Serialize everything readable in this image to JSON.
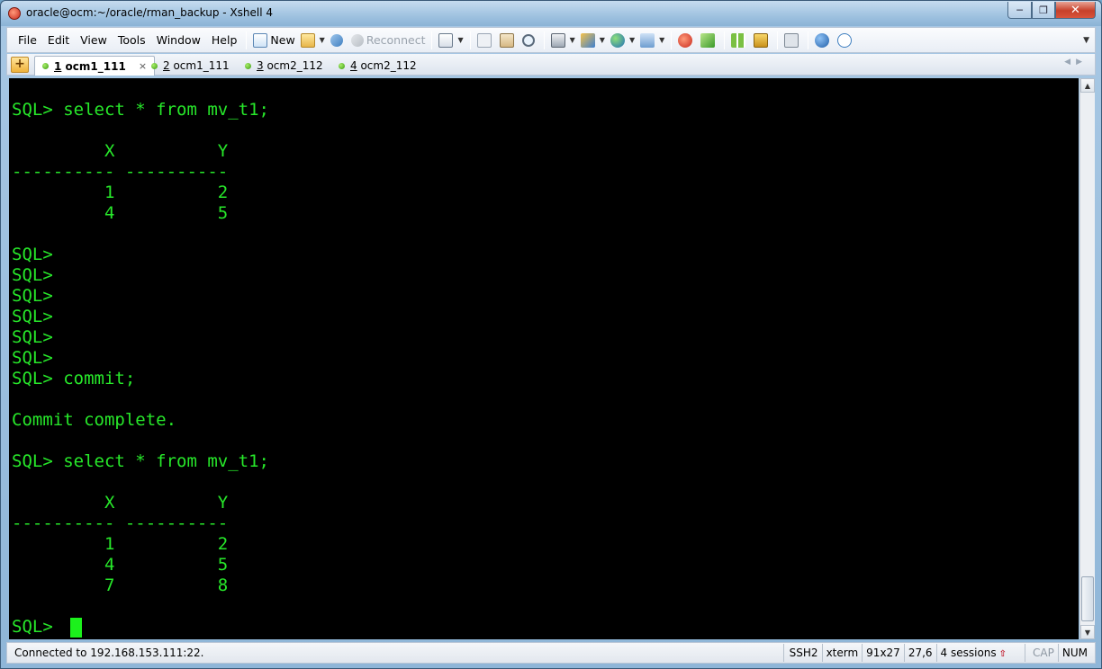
{
  "window": {
    "title": "oracle@ocm:~/oracle/rman_backup - Xshell 4"
  },
  "menu": [
    "File",
    "Edit",
    "View",
    "Tools",
    "Window",
    "Help"
  ],
  "toolbar": {
    "new_label": "New",
    "reconnect_label": "Reconnect"
  },
  "tabs": [
    {
      "num": "1",
      "name": "ocm1_111",
      "active": true
    },
    {
      "num": "2",
      "name": "ocm1_111",
      "active": false
    },
    {
      "num": "3",
      "name": "ocm2_112",
      "active": false
    },
    {
      "num": "4",
      "name": "ocm2_112",
      "active": false
    }
  ],
  "terminal": {
    "lines": [
      "SQL> select * from mv_t1;",
      "",
      "         X          Y",
      "---------- ----------",
      "         1          2",
      "         4          5",
      "",
      "SQL>",
      "SQL>",
      "SQL>",
      "SQL>",
      "SQL>",
      "SQL>",
      "SQL> commit;",
      "",
      "Commit complete.",
      "",
      "SQL> select * from mv_t1;",
      "",
      "         X          Y",
      "---------- ----------",
      "         1          2",
      "         4          5",
      "         7          8",
      "",
      "SQL> "
    ]
  },
  "status": {
    "connection": "Connected to 192.168.153.111:22.",
    "protocol": "SSH2",
    "term_type": "xterm",
    "size": "91x27",
    "cursor_pos": "27,6",
    "sessions": "4 sessions",
    "cap": "CAP",
    "num": "NUM"
  },
  "colors": {
    "terminal_bg": "#000000",
    "terminal_fg": "#27e82a",
    "cursor": "#1cf11c"
  }
}
